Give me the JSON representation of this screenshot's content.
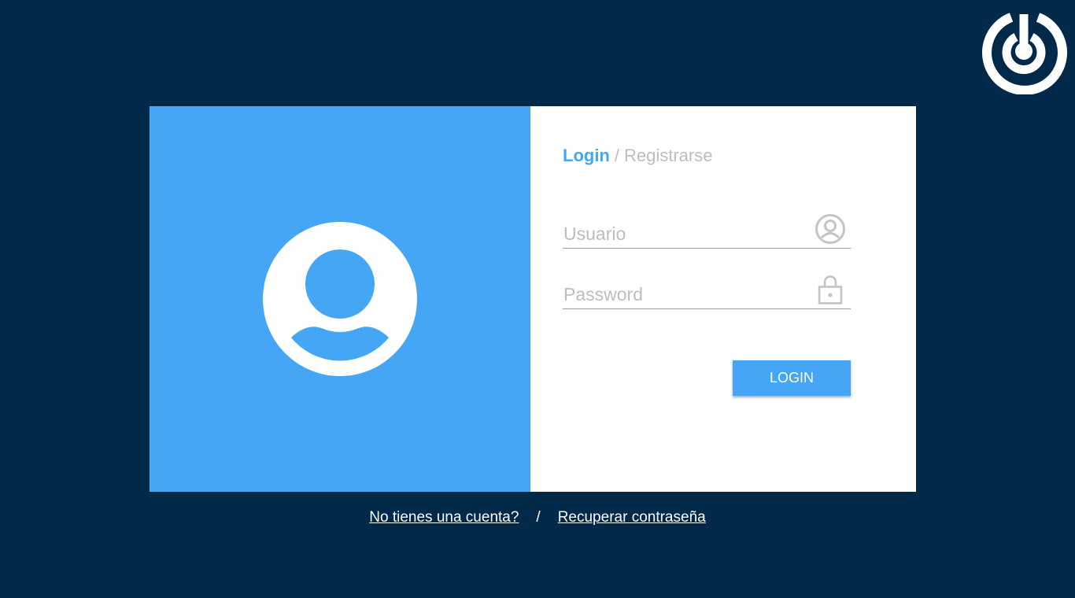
{
  "brand": {
    "logo_icon": "power-target-logo-icon",
    "background_color": "#01294A"
  },
  "left_panel": {
    "color": "#44A6F5",
    "avatar_icon": "user-avatar-icon"
  },
  "tabs": {
    "login_label": "Login",
    "separator": "/",
    "register_label": "Registrarse"
  },
  "form": {
    "username": {
      "placeholder": "Usuario",
      "value": "",
      "icon": "user-circle-icon"
    },
    "password": {
      "placeholder": "Password",
      "value": "",
      "icon": "lock-icon"
    },
    "submit_label": "LOGIN"
  },
  "footer": {
    "no_account_label": "No tienes una cuenta?",
    "separator": "/",
    "recover_label": "Recuperar contraseña"
  },
  "colors": {
    "accent": "#44A6F5",
    "muted_text": "#BDBDBD",
    "card_background": "#FFFFFF"
  }
}
